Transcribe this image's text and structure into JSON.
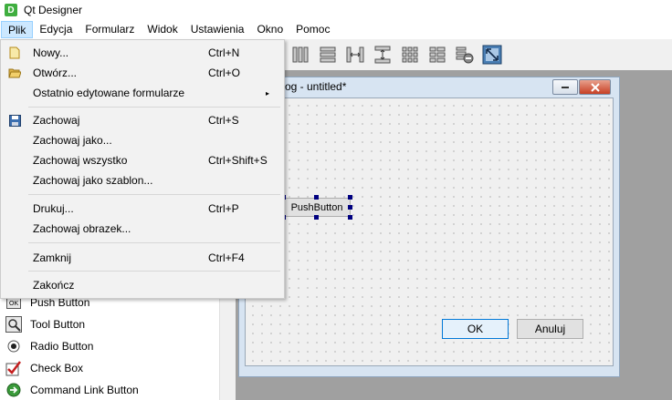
{
  "window": {
    "title": "Qt Designer",
    "app_icon_letter": "D"
  },
  "menubar": [
    "Plik",
    "Edycja",
    "Formularz",
    "Widok",
    "Ustawienia",
    "Okno",
    "Pomoc"
  ],
  "file_menu": {
    "items": [
      {
        "label": "Nowy...",
        "shortcut": "Ctrl+N",
        "icon": "new-file-icon"
      },
      {
        "label": "Otwórz...",
        "shortcut": "Ctrl+O",
        "icon": "open-folder-icon"
      },
      {
        "label": "Ostatnio edytowane formularze",
        "shortcut": "",
        "submenu": true
      },
      {
        "label": "Zachowaj",
        "shortcut": "Ctrl+S",
        "icon": "save-disk-icon"
      },
      {
        "label": "Zachowaj jako...",
        "shortcut": ""
      },
      {
        "label": "Zachowaj wszystko",
        "shortcut": "Ctrl+Shift+S"
      },
      {
        "label": "Zachowaj jako szablon...",
        "shortcut": ""
      },
      {
        "label": "Drukuj...",
        "shortcut": "Ctrl+P"
      },
      {
        "label": "Zachowaj obrazek...",
        "shortcut": ""
      },
      {
        "label": "Zamknij",
        "shortcut": "Ctrl+F4"
      },
      {
        "label": "Zakończ",
        "shortcut": ""
      }
    ],
    "submenu_arrow": "▸"
  },
  "widget_box": {
    "items": [
      {
        "label": "Push Button",
        "icon": "push-button-icon"
      },
      {
        "label": "Tool Button",
        "icon": "tool-button-icon"
      },
      {
        "label": "Radio Button",
        "icon": "radio-button-icon"
      },
      {
        "label": "Check Box",
        "icon": "check-box-icon"
      },
      {
        "label": "Command Link Button",
        "icon": "command-link-icon"
      }
    ]
  },
  "form_window": {
    "title": "og - untitled*",
    "push_button_label": "PushButton",
    "ok_label": "OK",
    "cancel_label": "Anuluj"
  },
  "toolbar": {
    "icons": [
      "layout-horizontal-icon",
      "layout-vertical-icon",
      "split-horizontal-icon",
      "split-vertical-icon",
      "layout-grid-icon",
      "layout-form-icon",
      "break-layout-icon",
      "adjust-size-icon"
    ]
  },
  "colors": {
    "accent": "#0078d7",
    "menu_highlight": "#cce8ff",
    "handle": "#000080",
    "close_button": "#c73f23"
  }
}
